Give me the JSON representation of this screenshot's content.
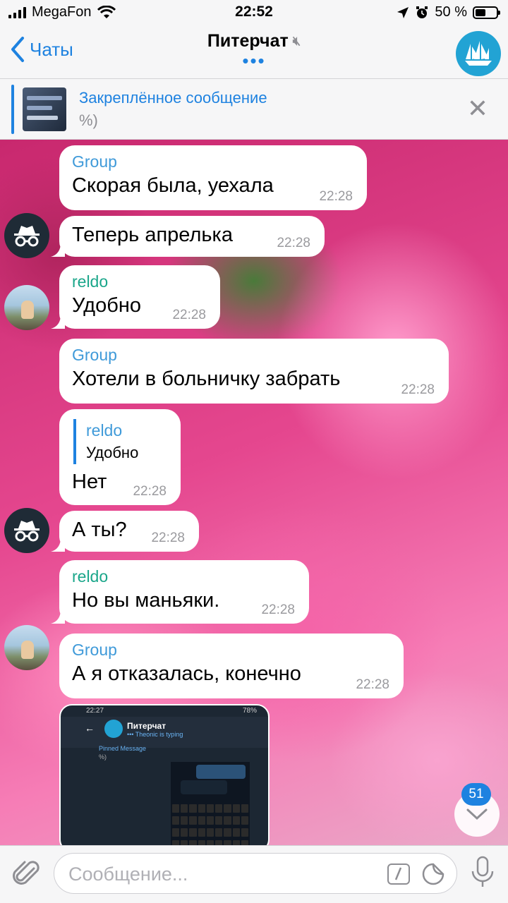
{
  "status_bar": {
    "carrier": "MegaFon",
    "time": "22:52",
    "battery_text": "50 %",
    "battery_level": 0.5
  },
  "nav": {
    "back_label": "Чаты",
    "title": "Питерчат",
    "typing_indicator": "•••"
  },
  "pinned": {
    "title": "Закреплённое сообщение",
    "text": "%)"
  },
  "messages": [
    {
      "sender": "Group",
      "text": "Скорая была, уехала",
      "time": "22:28"
    },
    {
      "sender": "",
      "text": "Теперь апрелька",
      "time": "22:28"
    },
    {
      "sender": "reldo",
      "text": "Удобно",
      "time": "22:28"
    },
    {
      "sender": "Group",
      "text": "Хотели в больничку забрать",
      "time": "22:28"
    },
    {
      "sender": "",
      "reply_name": "reldo",
      "reply_text": "Удобно",
      "text": "Нет",
      "time": "22:28"
    },
    {
      "sender": "",
      "text": "А ты?",
      "time": "22:28"
    },
    {
      "sender": "reldo",
      "text": "Но вы маньяки.",
      "time": "22:28"
    },
    {
      "sender": "Group",
      "text": "А я отказалась, конечно",
      "time": "22:28"
    }
  ],
  "media_preview": {
    "time": "22:27",
    "battery": "78%",
    "title": "Питерчат",
    "subtitle": "••• Theonic is typing",
    "pinned_title": "Pinned Message",
    "pinned_text": "%)"
  },
  "scroll": {
    "unread_count": "51"
  },
  "input": {
    "placeholder": "Сообщение..."
  },
  "colors": {
    "accent": "#1e82e0",
    "group_name": "#3f9ad9",
    "reldo_name": "#1aa68a",
    "incognito_avatar": "#1f2b36"
  }
}
